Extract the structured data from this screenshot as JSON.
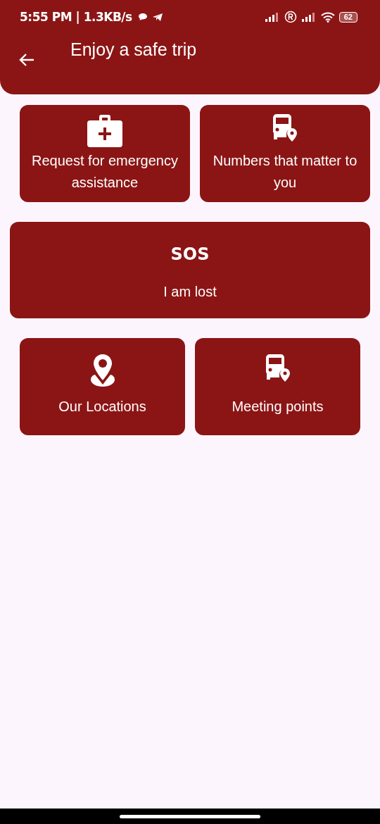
{
  "status_bar": {
    "time": "5:55 PM | 1.3KB/s",
    "battery": "62"
  },
  "header": {
    "title": "Enjoy a safe trip"
  },
  "rows": [
    {
      "tiles": [
        {
          "kind": "icon",
          "label": "Request for emergency assistance"
        },
        {
          "kind": "icon",
          "label": "Numbers that matter to you"
        }
      ]
    },
    {
      "tiles": [
        {
          "kind": "badge",
          "badge": "SOS",
          "label": "I am lost"
        }
      ]
    },
    {
      "tiles": [
        {
          "kind": "icon",
          "label": "Our Locations"
        },
        {
          "kind": "icon",
          "label": "Meeting points"
        }
      ]
    }
  ]
}
